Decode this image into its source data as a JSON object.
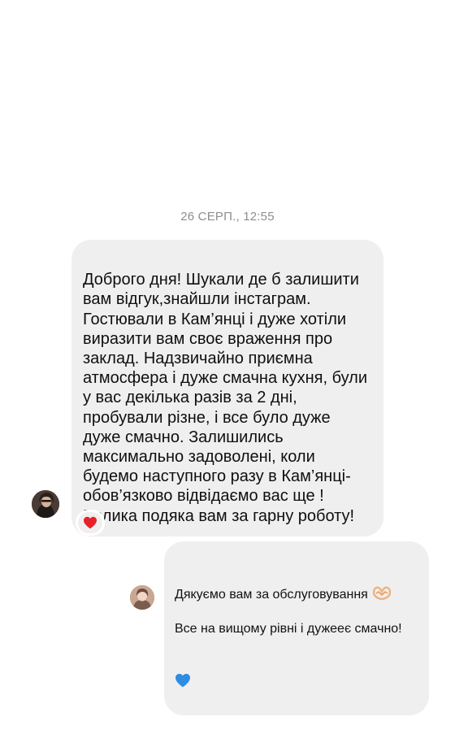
{
  "thread": {
    "timestamp": "26 СЕРП., 12:55"
  },
  "incoming_message": {
    "text": "Доброго дня! Шукали де б залишити\nвам відгук,знайшли інстаграм.\nГостювали в Кам’янці і дуже хотіли\nвиразити вам своє враження про\nзаклад. Надзвичайно приємна\nатмосфера і дуже смачна кухня, були\nу вас декілька разів за 2 дні,\nпробували різне, і все було дуже\nдуже смачно. Залишились\nмаксимально задоволені, коли\nбудемо наступного разу в Кам’янці-\nобов’язково відвідаємо вас ще !\nВелика подяка вам за гарну роботу!",
    "reaction_icon": "red-heart-icon",
    "avatar_icon": "user-avatar"
  },
  "outgoing_message": {
    "line1": "Дякуємо вам за обслуговування",
    "line1_icon": "heart-hands-icon",
    "line2": "Все на вищому рівні і дужееє смачно!",
    "line2_icon": "blue-heart-icon",
    "avatar_icon": "business-avatar"
  },
  "colors": {
    "bubble": "#efeff0",
    "timestamp": "#8e8e8e",
    "reaction_heart": "#e8202a",
    "blue_heart": "#2f8ce0"
  }
}
